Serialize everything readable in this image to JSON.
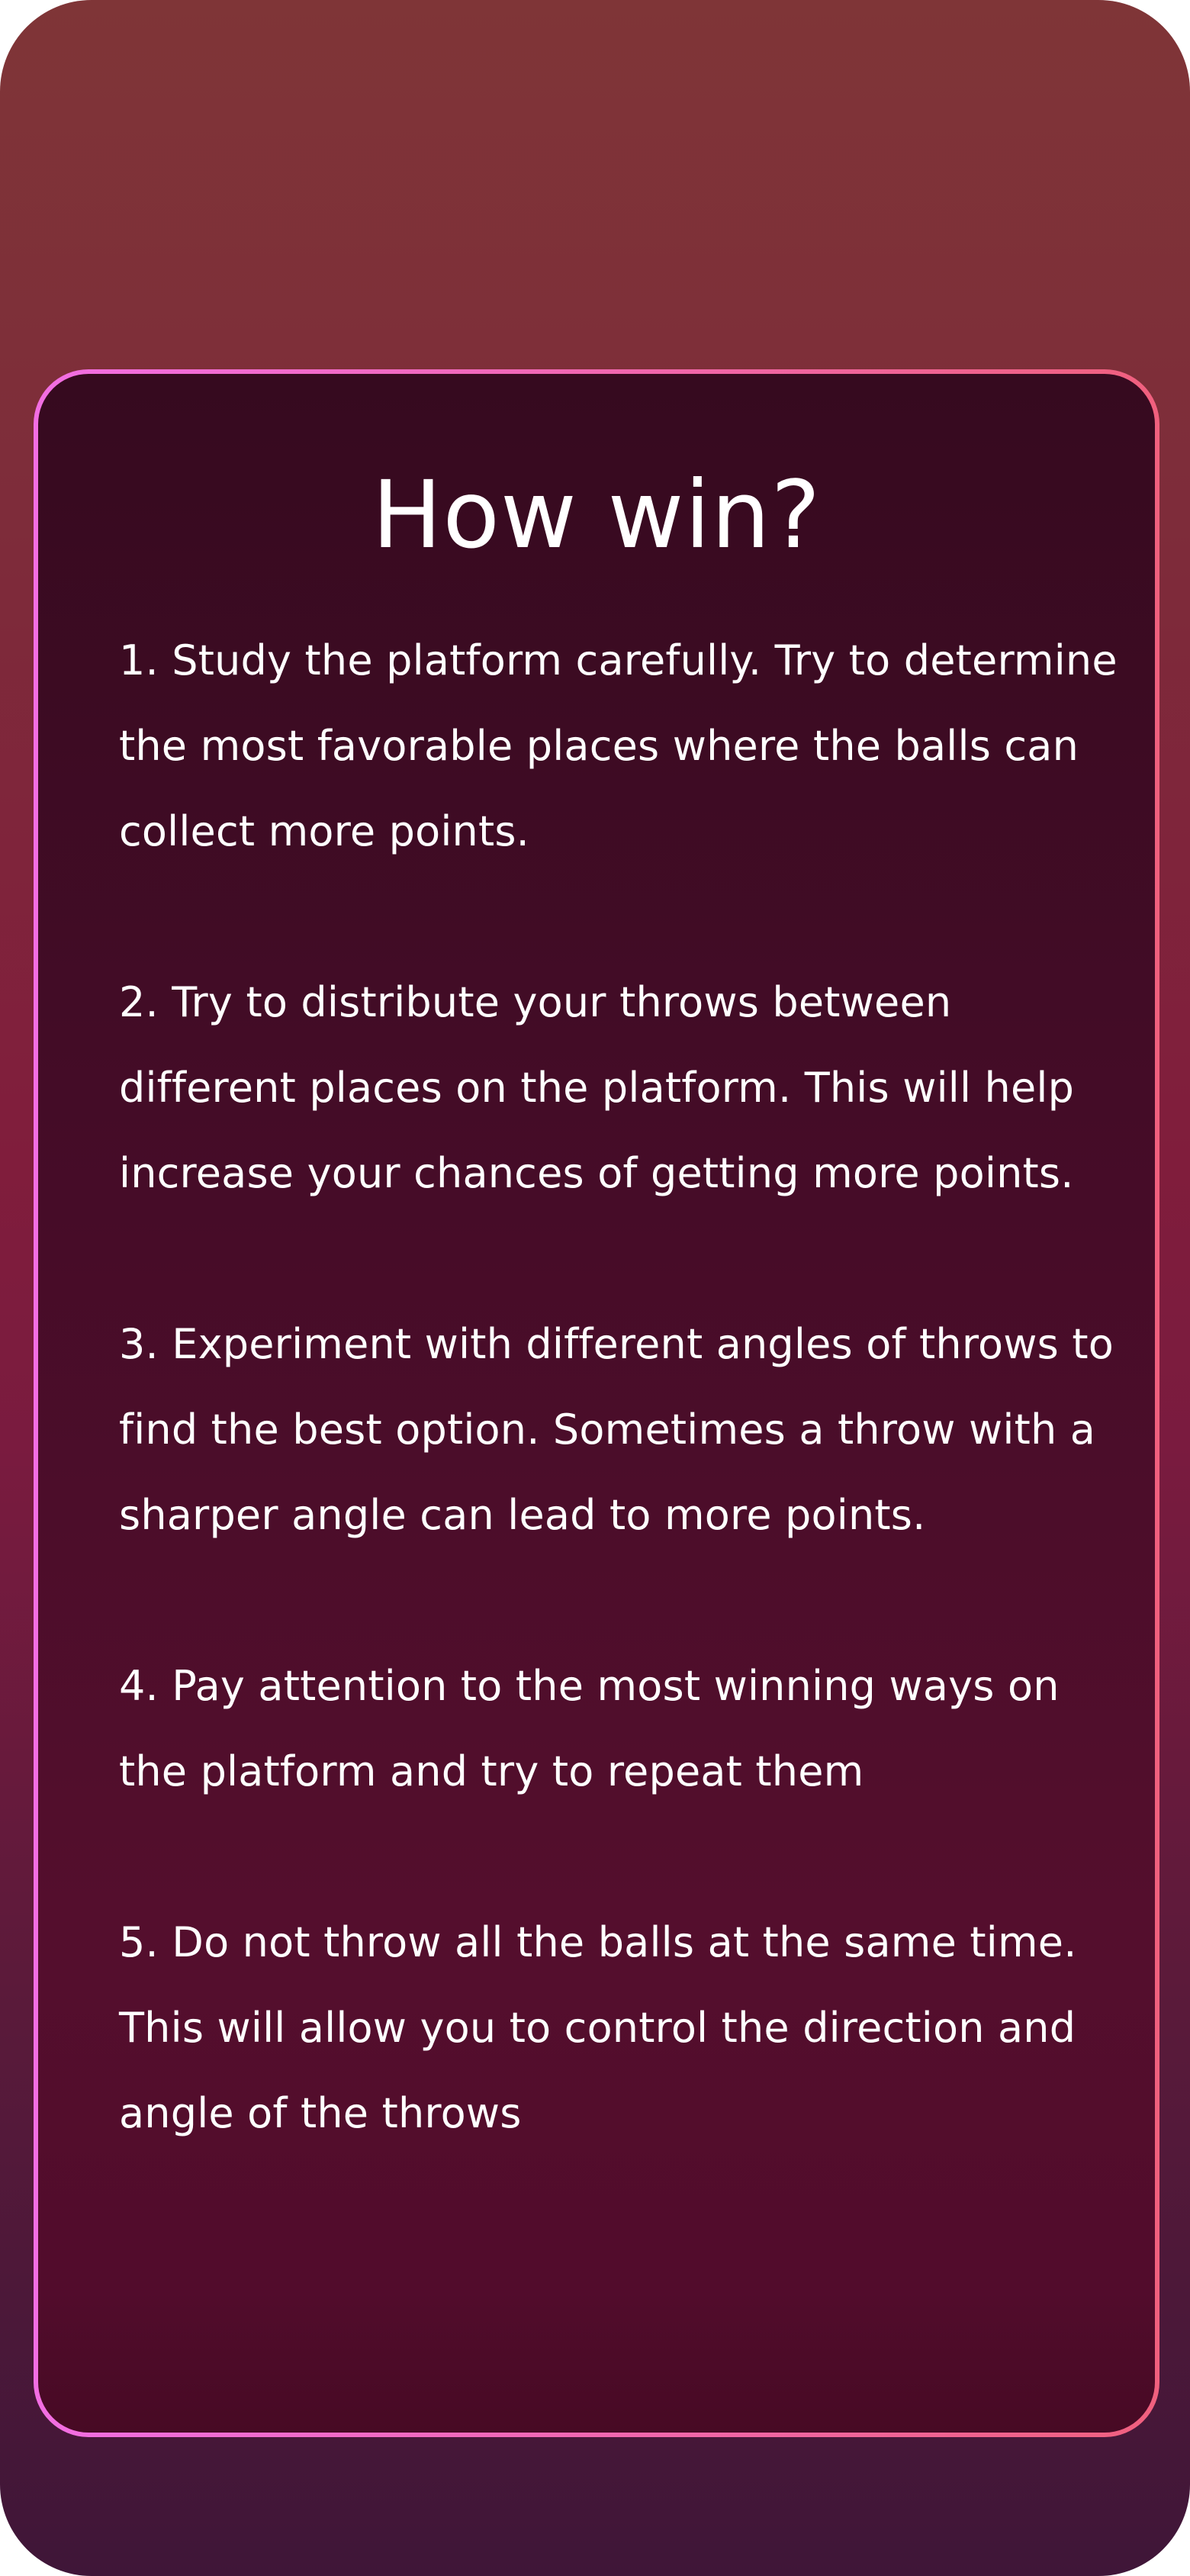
{
  "title": "How win?",
  "tips": [
    "1. Study the platform carefully. Try to determine the most favorable places where the balls can collect more points.",
    "2. Try to distribute your throws between different places on the platform. This will help increase your chances of getting more points.",
    "3. Experiment with different angles of throws to find the best option. Sometimes a throw with a sharper angle can lead to more points.",
    "4. Pay attention to the most winning ways on the platform and try to repeat them",
    "5. Do not throw all the balls at the same time. This will allow you to control the direction and angle of the throws"
  ],
  "colors": {
    "background_top": "#7f3537",
    "background_middle": "#801d3c",
    "background_bottom": "#3f1638",
    "panel_border_left": "#f26ee3",
    "panel_border_right": "#f0607e",
    "panel_fill": "#4a0c28",
    "text": "#ffffff"
  }
}
